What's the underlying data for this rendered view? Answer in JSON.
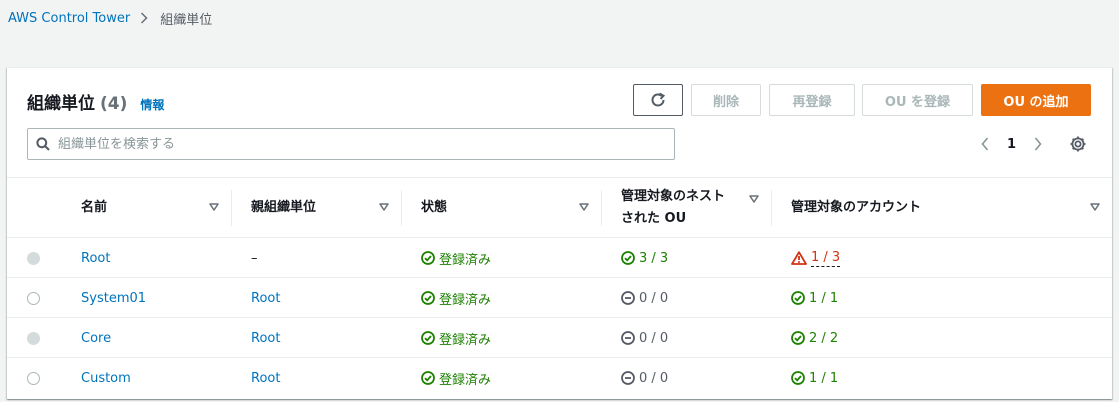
{
  "breadcrumb": {
    "root": "AWS Control Tower",
    "current": "組織単位"
  },
  "panel": {
    "title": "組織単位",
    "count": "(4)",
    "info": "情報",
    "buttons": {
      "delete": "削除",
      "reregister": "再登録",
      "register_ou": "OU を登録",
      "add_ou": "OU の追加"
    },
    "search": {
      "placeholder": "組織単位を検索する"
    },
    "pagination": {
      "page": "1"
    }
  },
  "table": {
    "headers": {
      "name": "名前",
      "parent": "親組織単位",
      "state": "状態",
      "nested_ou_line1": "管理対象のネスト",
      "nested_ou_line2": "された OU",
      "accounts": "管理対象のアカウント"
    },
    "rows": [
      {
        "name": "Root",
        "parent": "–",
        "parent_is_link": false,
        "state": "登録済み",
        "nested_ou": "3 / 3",
        "nested_status": "ok",
        "accounts": "1 / 3",
        "accounts_status": "warning",
        "radio_disabled": true
      },
      {
        "name": "System01",
        "parent": "Root",
        "parent_is_link": true,
        "state": "登録済み",
        "nested_ou": "0 / 0",
        "nested_status": "none",
        "accounts": "1 / 1",
        "accounts_status": "ok",
        "radio_disabled": false
      },
      {
        "name": "Core",
        "parent": "Root",
        "parent_is_link": true,
        "state": "登録済み",
        "nested_ou": "0 / 0",
        "nested_status": "none",
        "accounts": "2 / 2",
        "accounts_status": "ok",
        "radio_disabled": true
      },
      {
        "name": "Custom",
        "parent": "Root",
        "parent_is_link": true,
        "state": "登録済み",
        "nested_ou": "0 / 0",
        "nested_status": "none",
        "accounts": "1 / 1",
        "accounts_status": "ok",
        "radio_disabled": false
      }
    ]
  },
  "colors": {
    "link": "#0073bb",
    "success": "#1d8102",
    "warning": "#d13212",
    "primary_button": "#ec7211",
    "neutral": "#545b64"
  },
  "icons": {
    "breadcrumb_separator": "chevron-right-icon",
    "refresh": "refresh-icon",
    "search": "search-icon",
    "prev_page": "chevron-left-icon",
    "next_page": "chevron-right-icon",
    "settings": "gear-icon",
    "sort": "caret-down-icon",
    "ok": "check-circle-icon",
    "none": "minus-circle-icon",
    "warning": "warning-triangle-icon"
  }
}
